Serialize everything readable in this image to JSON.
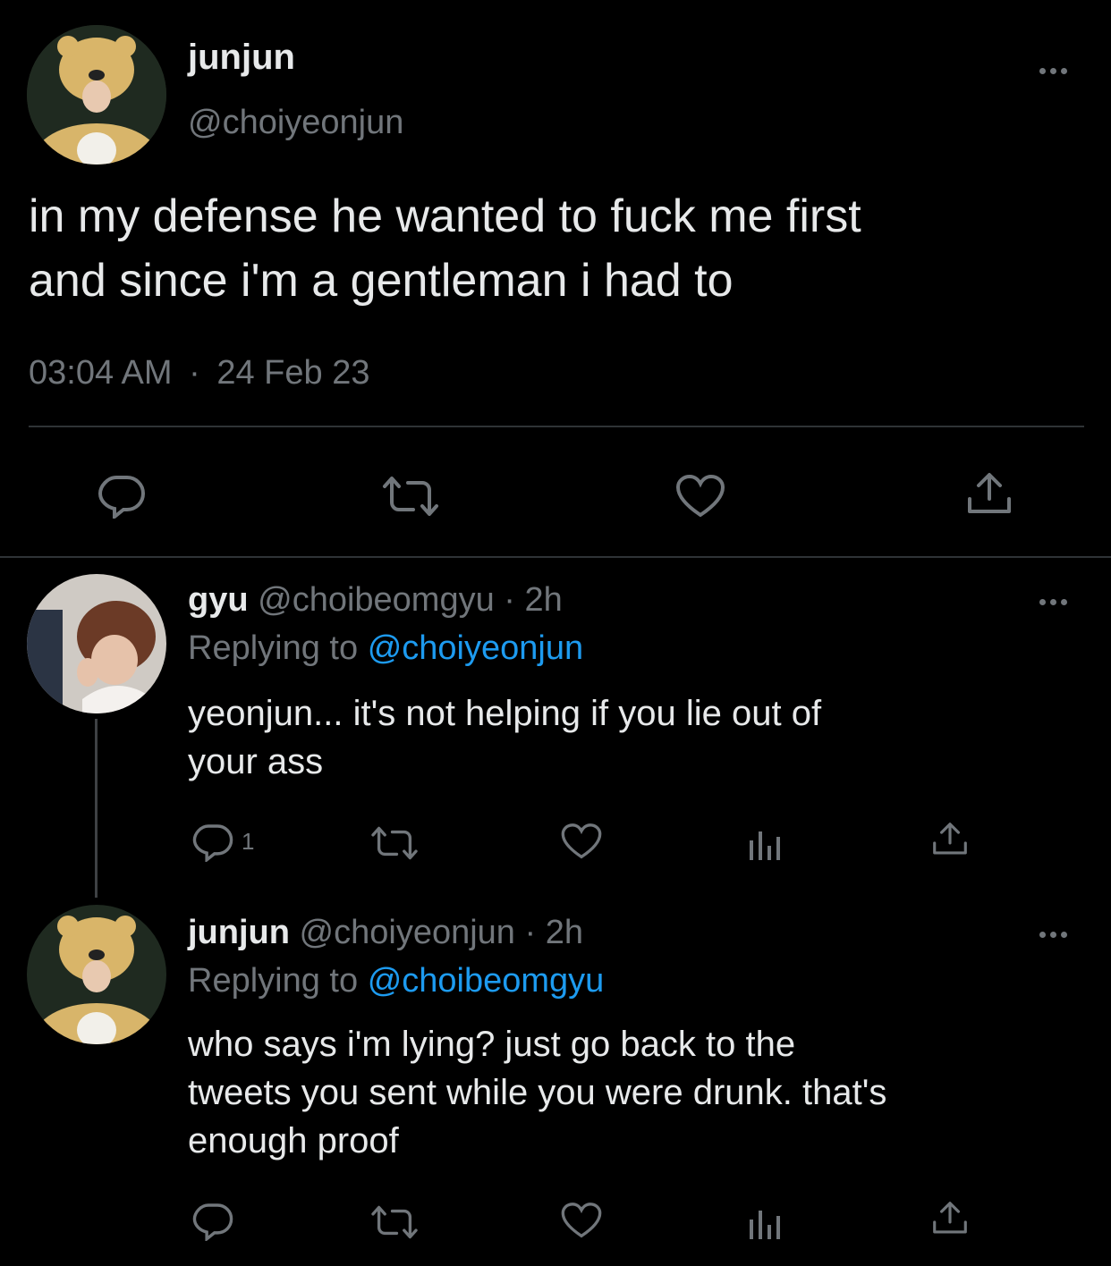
{
  "main_tweet": {
    "display_name": "junjun",
    "handle": "@choiyeonjun",
    "text_line1": "in my defense he wanted to fuck me first",
    "text_line2": "and since i'm a gentleman i had to",
    "time": "03:04 AM",
    "separator": "·",
    "date": "24 Feb 23",
    "avatar": "bear-costume-avatar"
  },
  "reply1": {
    "display_name": "gyu",
    "handle": "@choibeomgyu",
    "time": "· 2h",
    "replying_prefix": "Replying to",
    "replying_handle": "@choiyeonjun",
    "text_line1": "yeonjun... it's not helping if you lie out of",
    "text_line2": "your ass",
    "reply_count": "1",
    "avatar": "user-photo-avatar"
  },
  "reply2": {
    "display_name": "junjun",
    "handle": "@choiyeonjun",
    "time": "· 2h",
    "replying_prefix": "Replying to",
    "replying_handle": "@choibeomgyu",
    "text_line1": "who says i'm lying? just go back to the",
    "text_line2": "tweets you sent while you were drunk. that's",
    "text_line3": "enough proof",
    "avatar": "bear-costume-avatar"
  },
  "colors": {
    "background": "#000000",
    "text": "#e7e9ea",
    "muted": "#71767b",
    "link": "#1d9bf0",
    "divider": "#2f3336"
  },
  "icons": [
    "reply-icon",
    "retweet-icon",
    "like-icon",
    "share-icon",
    "analytics-icon",
    "more-icon"
  ]
}
